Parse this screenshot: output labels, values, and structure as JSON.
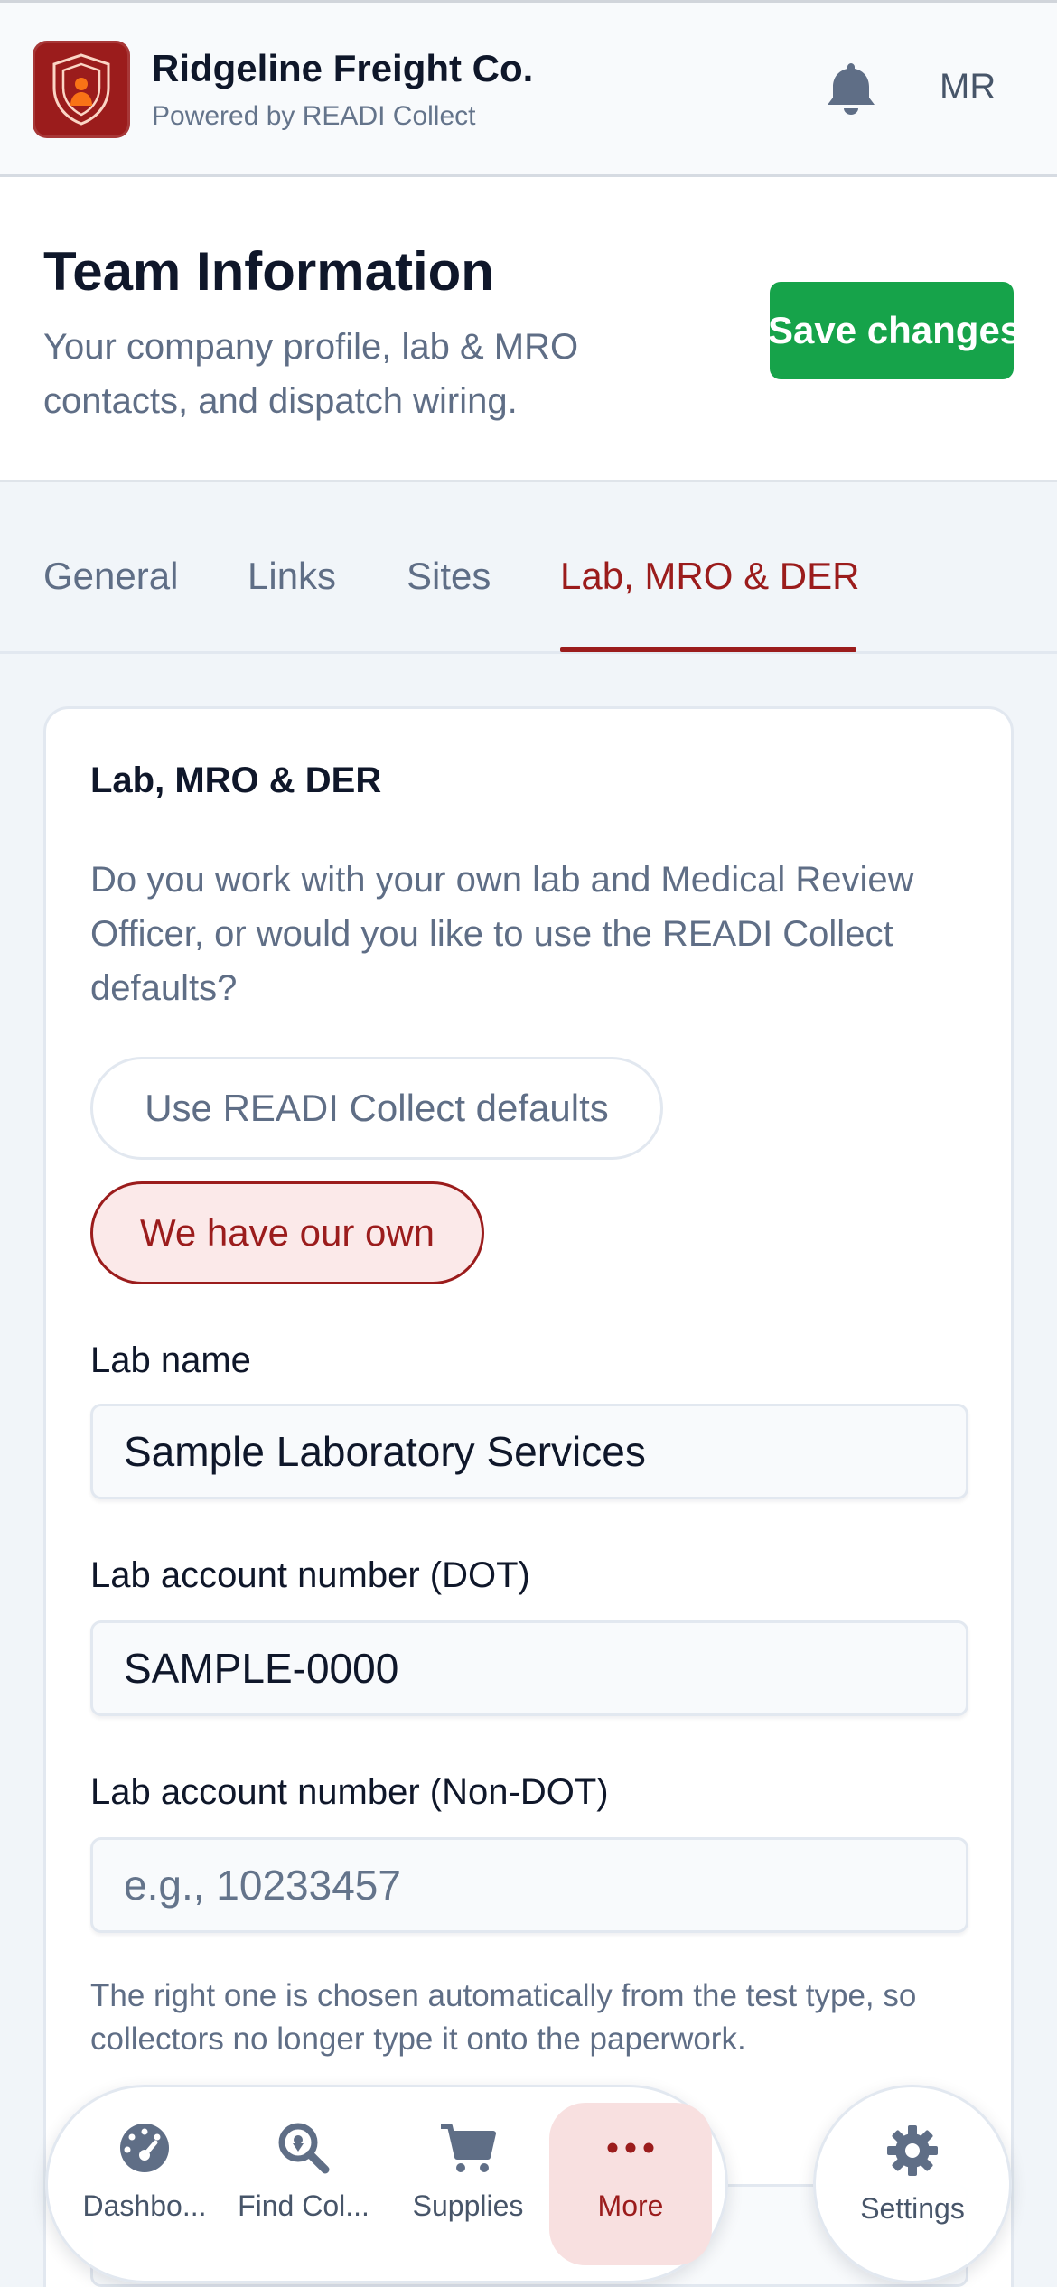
{
  "topbar": {
    "company_name": "Ridgeline Freight Co.",
    "powered_by": "Powered by READI Collect",
    "avatar_initials": "MR",
    "logo_icon": "shield-person-icon",
    "bell_icon": "bell-icon"
  },
  "header": {
    "title": "Team Information",
    "subtitle": "Your company profile, lab & MRO contacts, and dispatch wiring.",
    "save_label": "Save changes"
  },
  "tabs": [
    {
      "label": "General",
      "active": false
    },
    {
      "label": "Links",
      "active": false
    },
    {
      "label": "Sites",
      "active": false
    },
    {
      "label": "Lab, MRO & DER",
      "active": true
    }
  ],
  "section": {
    "title": "Lab, MRO & DER",
    "description": "Do you work with your own lab and Medical Review Officer, or would you like to use the READI Collect defaults?",
    "option_defaults": "Use READI Collect defaults",
    "option_own": "We have our own",
    "selected_option": "We have our own",
    "fields": {
      "lab_name_label": "Lab name",
      "lab_name_value": "Sample Laboratory Services",
      "lab_dot_label": "Lab account number (DOT)",
      "lab_dot_value": "SAMPLE-0000",
      "lab_nondot_label": "Lab account number (Non-DOT)",
      "lab_nondot_value": "",
      "lab_nondot_placeholder": "e.g., 10233457"
    },
    "hint": "The right one is chosen automatically from the test type, so collectors no longer type it onto the paperwork."
  },
  "bottom_nav": {
    "items": [
      {
        "label": "Dashbo...",
        "icon": "speedometer-icon",
        "active": false
      },
      {
        "label": "Find Col...",
        "icon": "map-search-icon",
        "active": false
      },
      {
        "label": "Supplies",
        "icon": "cart-icon",
        "active": false
      },
      {
        "label": "More",
        "icon": "more-dots-icon",
        "active": true
      }
    ],
    "settings_label": "Settings",
    "settings_icon": "gear-icon"
  },
  "colors": {
    "brand": "#9b1c1c",
    "save_green": "#16a34a",
    "muted_text": "#5f6e86"
  }
}
